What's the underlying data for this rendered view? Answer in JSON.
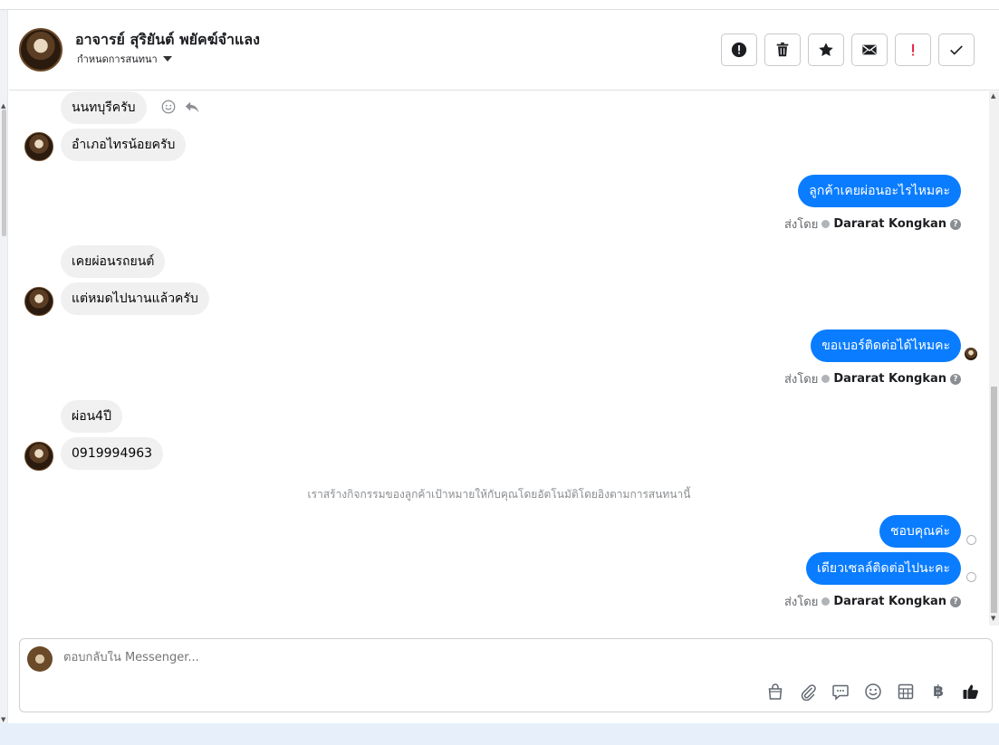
{
  "header": {
    "name": "อาจารย์ สุริยันต์ พยัคฆ์จำแลง",
    "sub_label": "กำหนดการสนทนา"
  },
  "messages": {
    "in1": "นนทบุรีครับ",
    "in2": "อำเภอไทรน้อยครับ",
    "out1": "ลูกค้าเคยผ่อนอะไรไหมคะ",
    "in3": "เคยผ่อนรถยนต์",
    "in4": "แต่หมดไปนานแล้วครับ",
    "out2": "ขอเบอร์ติดต่อได้ไหมคะ",
    "in5": "ผ่อน4ปี",
    "in6": "0919994963",
    "system_note": "เราสร้างกิจกรรมของลูกค้าเป้าหมายให้กับคุณโดยอัตโนมัติโดยอิงตามการสนทนานี้",
    "out3": "ชอบคุณค่ะ",
    "out4": "เดียวเซลล์ติดต่อไปนะคะ"
  },
  "sent_by": {
    "prefix": "ส่งโดย",
    "agent": "Dararat Kongkan",
    "help": "?"
  },
  "composer": {
    "placeholder": "ตอบกลับใน Messenger..."
  },
  "colors": {
    "outgoing_bubble": "#0a7cff",
    "incoming_bubble": "#f0f0f0",
    "spam_red": "#e41e3f"
  },
  "icons": {
    "tools": [
      "shopping-bag-icon",
      "paperclip-icon",
      "saved-reply-icon",
      "emoji-icon",
      "appointment-icon",
      "baht-icon",
      "like-icon"
    ]
  }
}
